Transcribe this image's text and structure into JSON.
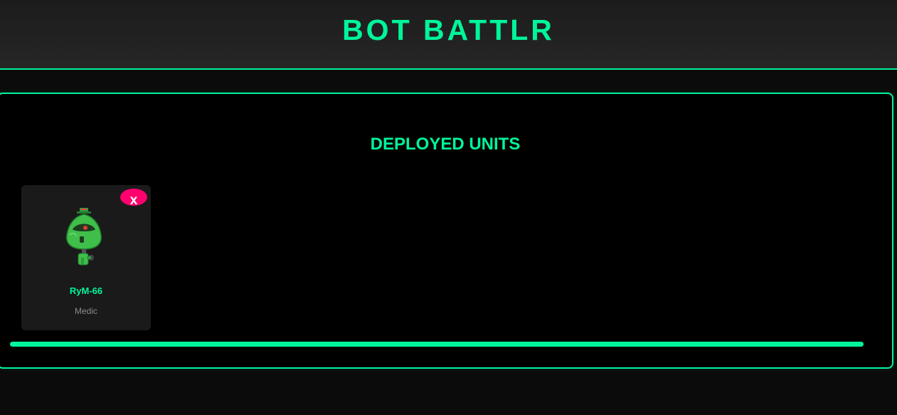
{
  "app": {
    "title": "BOT BATTLR"
  },
  "deployed": {
    "heading": "DEPLOYED UNITS",
    "units": [
      {
        "name": "RyM-66",
        "class": "Medic",
        "remove_label": "x",
        "avatar_icon": "green-medic-robot-icon"
      }
    ],
    "progress": 1.0
  },
  "colors": {
    "accent": "#00f59a",
    "danger": "#ff006e",
    "card_bg": "#1a1a1a",
    "panel_bg": "#000000",
    "page_bg": "#0b0b0b",
    "muted_text": "#8a8a8a"
  }
}
